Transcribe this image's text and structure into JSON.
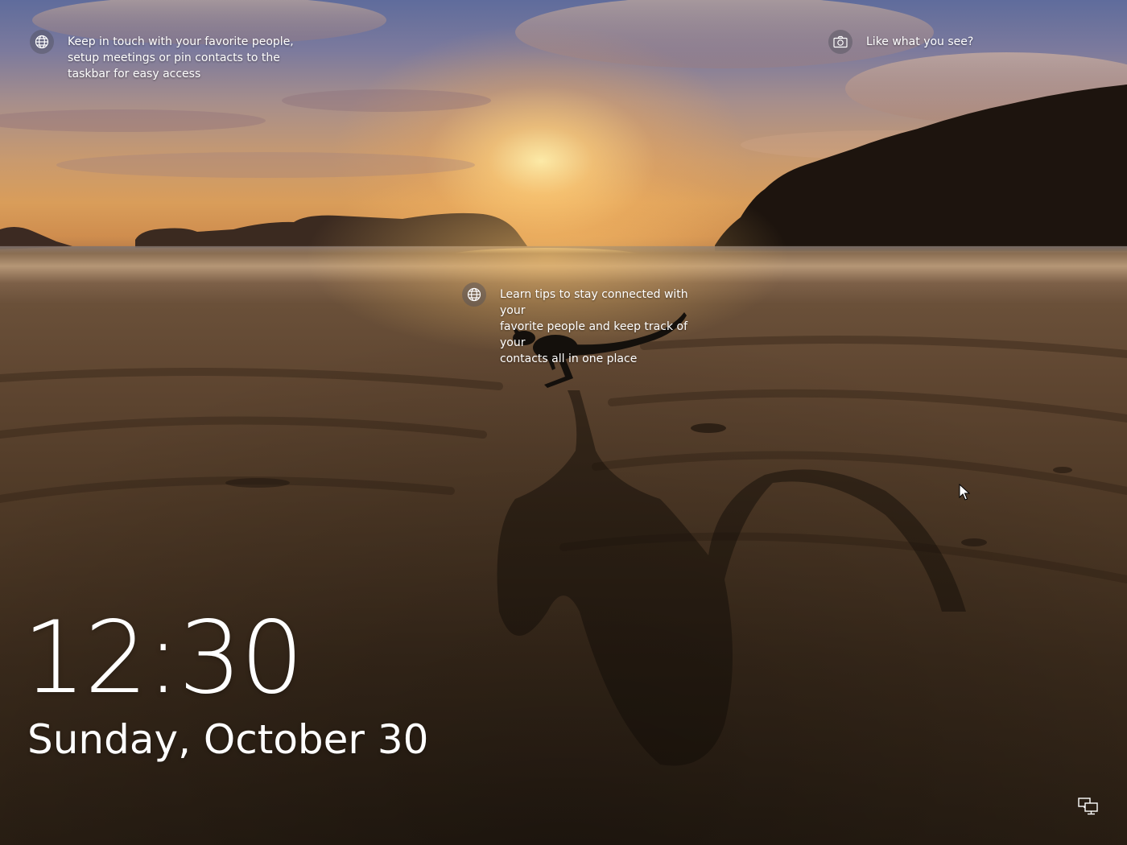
{
  "spotlight": {
    "top_left": {
      "icon": "globe-icon",
      "text": "Keep in touch with your favorite people,\nsetup meetings or pin contacts to the\ntaskbar for easy access"
    },
    "top_right": {
      "icon": "camera-icon",
      "text": "Like what you see?"
    },
    "center": {
      "icon": "globe-icon",
      "text": "Learn tips to stay connected with your\nfavorite people and keep track of your\ncontacts all in one place"
    }
  },
  "clock": {
    "time": "12:30",
    "date": "Sunday, October 30"
  },
  "status": {
    "network_icon": "network-wired-icon"
  },
  "colors": {
    "text": "#ffffff",
    "sky_top": "#5f6c9c",
    "sun": "#ffe6a0",
    "sand": "#4e3926"
  }
}
